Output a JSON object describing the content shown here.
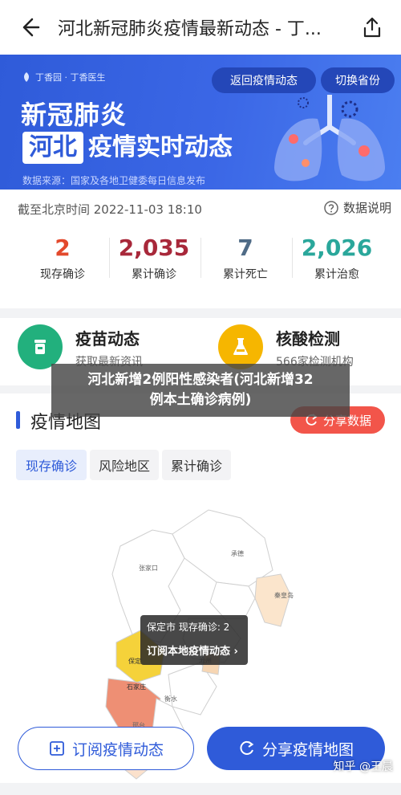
{
  "header": {
    "title": "河北新冠肺炎疫情最新动态 - 丁..."
  },
  "banner": {
    "brand": "丁香园 · 丁香医生",
    "back_button": "返回疫情动态",
    "switch_button": "切换省份",
    "title_line1": "新冠肺炎",
    "province": "河北",
    "title_line2": "疫情实时动态",
    "source": "数据来源：国家及各地卫健委每日信息发布"
  },
  "stats": {
    "as_of": "截至北京时间 2022-11-03 18:10",
    "data_note": "数据说明",
    "items": [
      {
        "value": "2",
        "label": "现存确诊",
        "color": "#e3492c"
      },
      {
        "value": "2,035",
        "label": "累计确诊",
        "color": "#a8283a"
      },
      {
        "value": "7",
        "label": "累计死亡",
        "color": "#4f6b86"
      },
      {
        "value": "2,026",
        "label": "累计治愈",
        "color": "#2aa79b"
      }
    ]
  },
  "services": {
    "vaccine": {
      "title": "疫苗动态",
      "sub": "获取最新资讯",
      "color": "#22b07d"
    },
    "nucleic": {
      "title": "核酸检测",
      "sub": "566家检测机构",
      "color": "#f6b600"
    }
  },
  "overlay": {
    "line1": "河北新增2例阳性感染者(河北新增32",
    "line2": "例本土确诊病例)"
  },
  "map": {
    "title": "疫情地图",
    "share_data": "分享数据",
    "tabs": [
      "现存确诊",
      "风险地区",
      "累计确诊"
    ],
    "active_tab": 0,
    "cities": [
      "张家口",
      "承德",
      "秦皇岛",
      "保定",
      "沧州",
      "石家庄",
      "衡水",
      "邢台"
    ],
    "tooltip_line1": "保定市 现存确诊: 2",
    "tooltip_line2": "订阅本地疫情动态 ›"
  },
  "bottom": {
    "subscribe": "订阅疫情动态",
    "share_map": "分享疫情地图"
  },
  "watermark": "知乎 @王晨"
}
